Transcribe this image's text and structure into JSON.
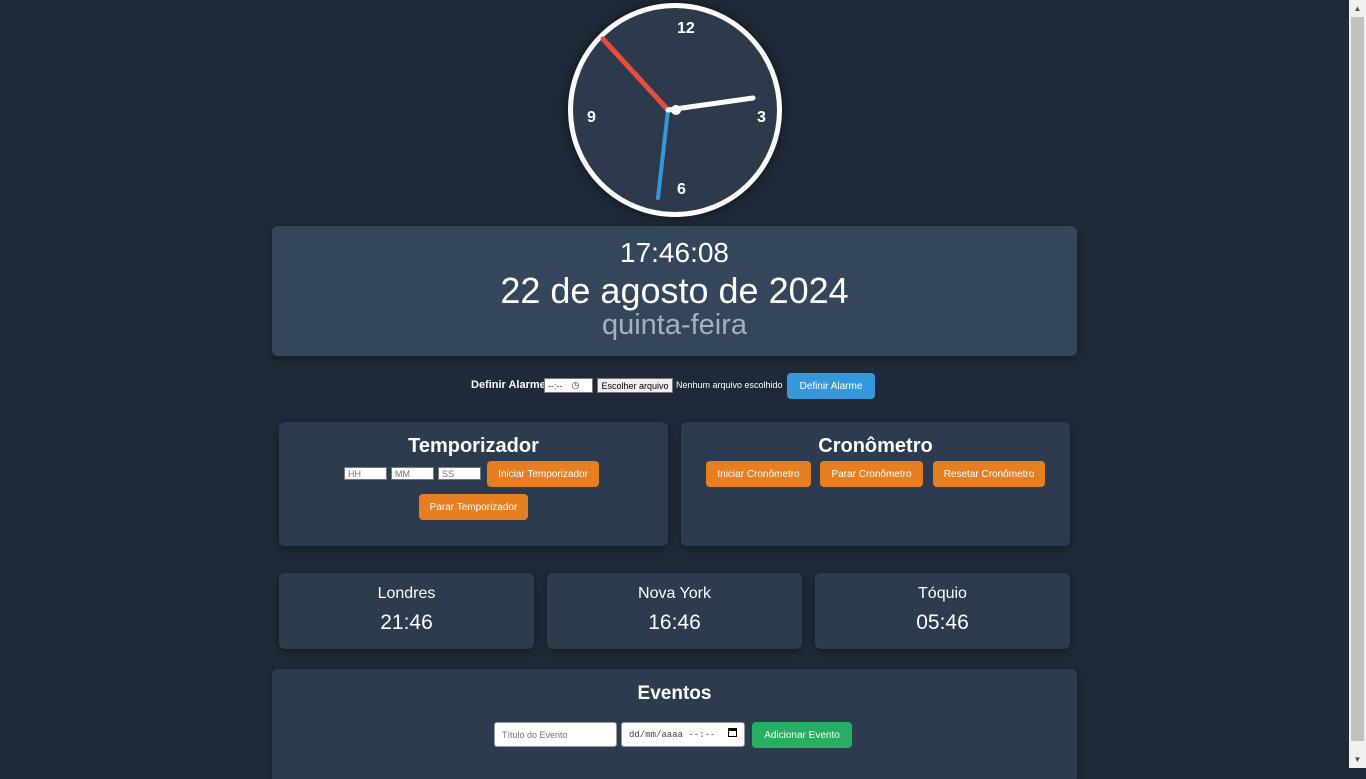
{
  "clock": {
    "numbers": [
      "12",
      "3",
      "6",
      "9"
    ],
    "time_shown": "17:46:08",
    "colors": {
      "hour_hand": "#ffffff",
      "minute_hand": "#3498db",
      "second_hand": "#e74c3c"
    }
  },
  "datetime": {
    "time": "17:46:08",
    "date": "22 de agosto de 2024",
    "weekday": "quinta-feira"
  },
  "alarm": {
    "label": "Definir Alarme:",
    "time_value": "--:--",
    "file_button": "Escolher arquivo",
    "file_status": "Nenhum arquivo escolhido",
    "set_button": "Definir Alarme"
  },
  "timer": {
    "title": "Temporizador",
    "hh_placeholder": "HH",
    "mm_placeholder": "MM",
    "ss_placeholder": "SS",
    "start_button": "Iniciar Temporizador",
    "stop_button": "Parar Temporizador"
  },
  "stopwatch": {
    "title": "Cronômetro",
    "start_button": "Iniciar Cronômetro",
    "stop_button": "Parar Cronômetro",
    "reset_button": "Resetar Cronômetro"
  },
  "world_clocks": [
    {
      "city": "Londres",
      "time": "21:46"
    },
    {
      "city": "Nova York",
      "time": "16:46"
    },
    {
      "city": "Tóquio",
      "time": "05:46"
    }
  ],
  "events": {
    "title": "Eventos",
    "title_placeholder": "Título do Evento",
    "datetime_value": "dd/mm/aaaa --:--",
    "add_button": "Adicionar Evento"
  },
  "icons": [
    "clock-icon",
    "calendar-icon",
    "scroll-up-arrow-icon",
    "scroll-down-arrow-icon"
  ],
  "colors": {
    "background": "#1f2937",
    "panel": "#34465c",
    "card": "#2d3b4e",
    "orange": "#e67e22",
    "blue": "#3498db",
    "green": "#27ae60"
  }
}
